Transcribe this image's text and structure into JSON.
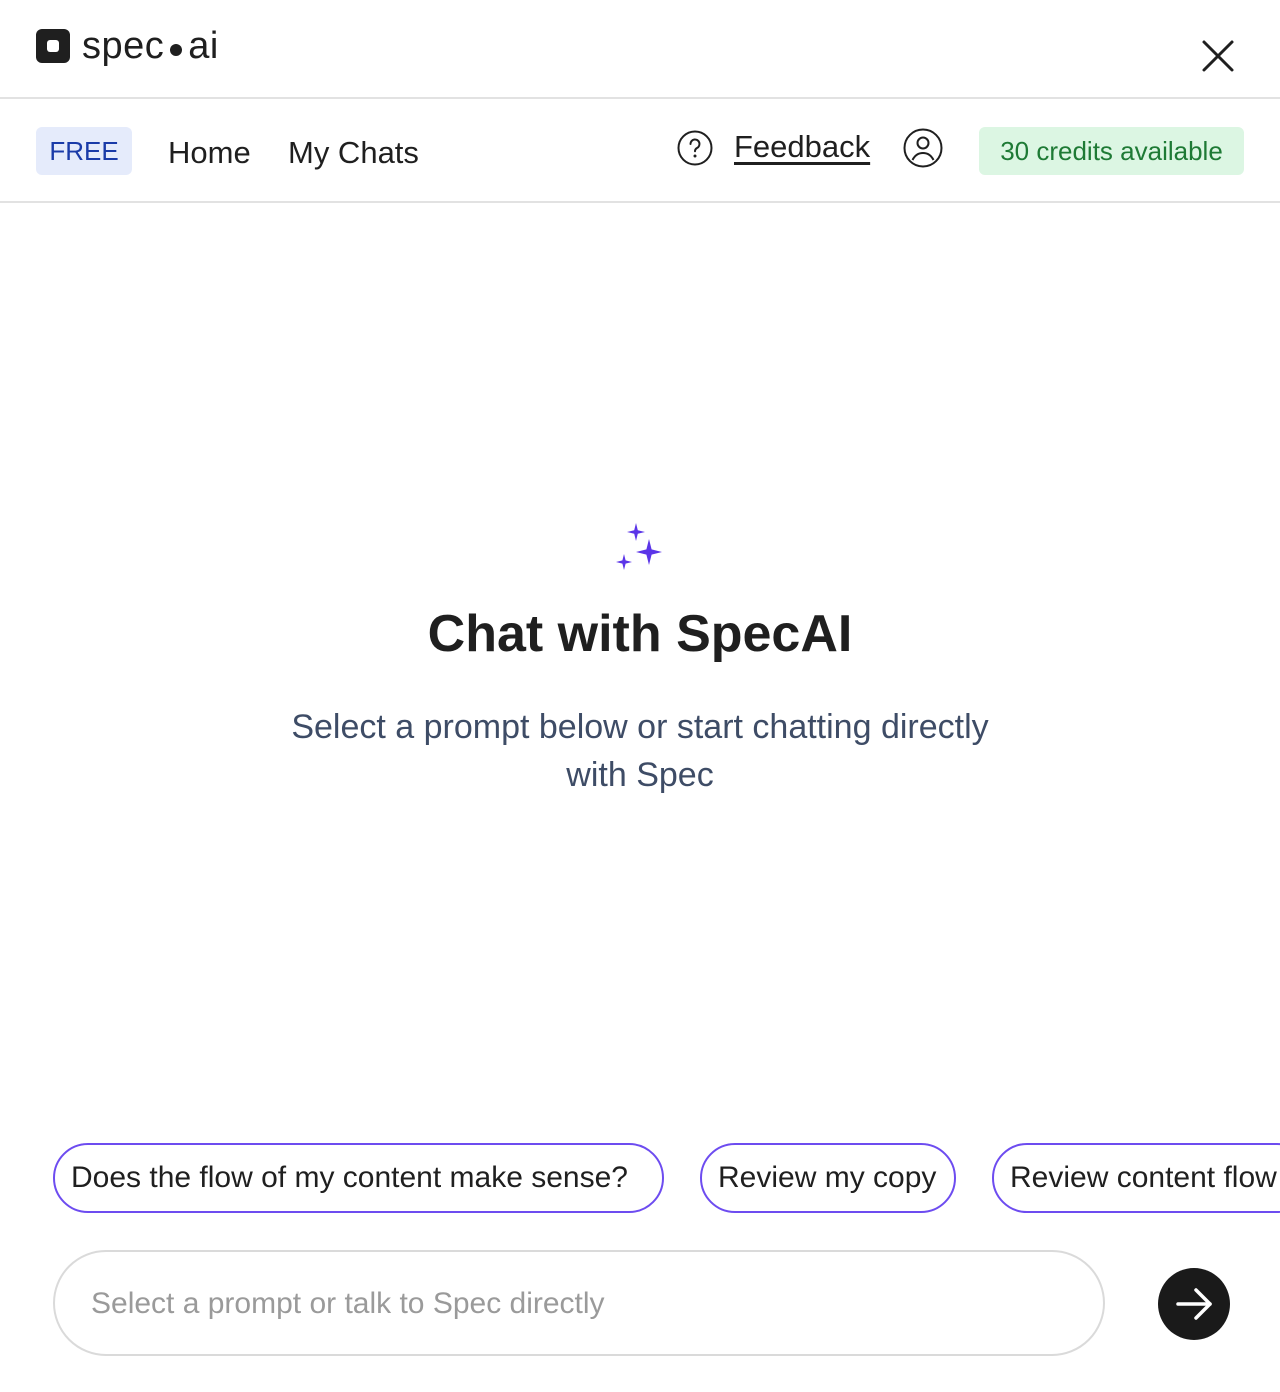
{
  "brand": {
    "name_left": "spec",
    "name_right": "ai"
  },
  "nav": {
    "plan_badge": "FREE",
    "home": "Home",
    "my_chats": "My Chats",
    "feedback": "Feedback",
    "credits": "30 credits available"
  },
  "main": {
    "title": "Chat with SpecAI",
    "subtitle": "Select a prompt below or start chatting directly with Spec"
  },
  "prompts": [
    "Does the flow of my content make sense?",
    "Review my copy",
    "Review content flow"
  ],
  "composer": {
    "placeholder": "Select a prompt or talk to Spec directly"
  },
  "icons": {
    "logo": "spec-logo-icon",
    "close": "close-icon",
    "help": "help-circle-icon",
    "user": "user-circle-icon",
    "sparkle": "sparkle-icon",
    "send": "arrow-right-icon"
  },
  "colors": {
    "accent": "#6d4cf0",
    "free_badge_bg": "#e5ebfb",
    "free_badge_text": "#1a3ba8",
    "credits_bg": "#dcf6e3",
    "credits_text": "#1e7a35",
    "send_bg": "#1a1a1a"
  }
}
